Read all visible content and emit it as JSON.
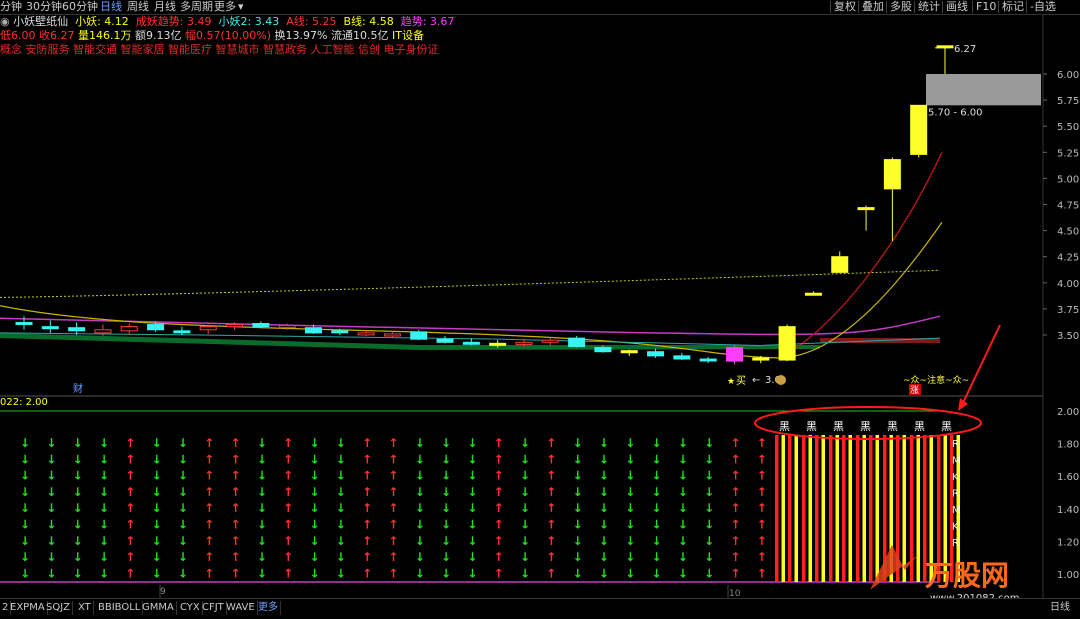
{
  "toolbar": {
    "left_items": [
      "分钟",
      "30分钟",
      "60分钟",
      "日线",
      "周线",
      "月线",
      "多周期",
      "更多"
    ],
    "active": "日线",
    "right_items": [
      "复权",
      "叠加",
      "多股",
      "统计",
      "画线",
      "F10",
      "标记",
      "-自选"
    ]
  },
  "indicator_line": {
    "name": "小妖壁纸仙",
    "items": [
      {
        "label": "小妖:",
        "value": "4.12",
        "color": "#ffff00"
      },
      {
        "label": "成妖趋势:",
        "value": "3.49",
        "color": "#ff3030"
      },
      {
        "label": "小妖2:",
        "value": "3.43",
        "color": "#3cf0f0"
      },
      {
        "label": "A线:",
        "value": "5.25",
        "color": "#ff3030"
      },
      {
        "label": "B线:",
        "value": "4.58",
        "color": "#ffff00"
      },
      {
        "label": "趋势:",
        "value": "3.67",
        "color": "#ff3cff"
      }
    ]
  },
  "quote_line": {
    "items": [
      {
        "text": "低6.00",
        "color": "#ff3030"
      },
      {
        "text": "收6.27",
        "color": "#ff3030"
      },
      {
        "text": "量146.1万",
        "color": "#ffff00"
      },
      {
        "text": "额9.13亿",
        "color": "#ddd"
      },
      {
        "text": "幅0.57(10.00%)",
        "color": "#ff3030"
      },
      {
        "text": "换13.97%",
        "color": "#ddd"
      },
      {
        "text": "流通10.5亿",
        "color": "#ddd"
      },
      {
        "text": "IT设备",
        "color": "#ffff00"
      }
    ]
  },
  "concepts": "概念 安防服务 智能交通 智能家居 智能医疗 智慧城市 智慧政务 人工智能 信创 电子身份证",
  "price_axis": [
    "6.00",
    "5.75",
    "5.50",
    "5.25",
    "5.00",
    "4.75",
    "4.50",
    "4.25",
    "4.00",
    "3.75",
    "3.50"
  ],
  "annotations": {
    "high_label": "6.27",
    "range_label": "5.70 - 6.00",
    "buy_label": "买",
    "price_mark": "3.0",
    "zhang_label": "涨",
    "wave_label": "~众~注意~众~",
    "cai_label": "财",
    "month_9": "9",
    "month_10": "10"
  },
  "lower_panel": {
    "indicator_label": "022: 2.00",
    "axis": [
      "2.00",
      "1.80",
      "1.60",
      "1.40",
      "1.20",
      "1.00"
    ],
    "top_labels": [
      "黑",
      "黑",
      "黑",
      "黑",
      "黑",
      "黑",
      "黑"
    ],
    "side_letters": [
      "R",
      "M",
      "K",
      "R",
      "M",
      "K",
      "R"
    ]
  },
  "bottom_tabs": [
    "2",
    "EXPMA",
    "SQJZ",
    "XT",
    "BBIBOLL",
    "GMMA",
    "CYX",
    "CFJT",
    "WAVE",
    "更多"
  ],
  "period_label": "日线",
  "watermark": {
    "brand": "万股网",
    "url": "www.201082.com"
  },
  "chart_data": {
    "type": "candlestick",
    "candles": [
      {
        "o": 3.62,
        "h": 3.68,
        "l": 3.55,
        "c": 3.6,
        "col": "cyan"
      },
      {
        "o": 3.58,
        "h": 3.64,
        "l": 3.52,
        "c": 3.56,
        "col": "cyan"
      },
      {
        "o": 3.57,
        "h": 3.62,
        "l": 3.5,
        "c": 3.54,
        "col": "cyan"
      },
      {
        "o": 3.52,
        "h": 3.6,
        "l": 3.49,
        "c": 3.55,
        "col": "red"
      },
      {
        "o": 3.54,
        "h": 3.61,
        "l": 3.5,
        "c": 3.58,
        "col": "red"
      },
      {
        "o": 3.6,
        "h": 3.63,
        "l": 3.53,
        "c": 3.55,
        "col": "cyan"
      },
      {
        "o": 3.54,
        "h": 3.58,
        "l": 3.5,
        "c": 3.53,
        "col": "cyan"
      },
      {
        "o": 3.55,
        "h": 3.6,
        "l": 3.51,
        "c": 3.58,
        "col": "red"
      },
      {
        "o": 3.58,
        "h": 3.62,
        "l": 3.55,
        "c": 3.6,
        "col": "red"
      },
      {
        "o": 3.61,
        "h": 3.63,
        "l": 3.57,
        "c": 3.58,
        "col": "cyan"
      },
      {
        "o": 3.58,
        "h": 3.61,
        "l": 3.55,
        "c": 3.59,
        "col": "red"
      },
      {
        "o": 3.57,
        "h": 3.6,
        "l": 3.51,
        "c": 3.52,
        "col": "cyan"
      },
      {
        "o": 3.53,
        "h": 3.56,
        "l": 3.5,
        "c": 3.54,
        "col": "cyan"
      },
      {
        "o": 3.52,
        "h": 3.55,
        "l": 3.49,
        "c": 3.51,
        "col": "red"
      },
      {
        "o": 3.51,
        "h": 3.54,
        "l": 3.48,
        "c": 3.5,
        "col": "red"
      },
      {
        "o": 3.53,
        "h": 3.55,
        "l": 3.45,
        "c": 3.46,
        "col": "cyan"
      },
      {
        "o": 3.46,
        "h": 3.49,
        "l": 3.42,
        "c": 3.43,
        "col": "cyan"
      },
      {
        "o": 3.43,
        "h": 3.47,
        "l": 3.4,
        "c": 3.42,
        "col": "cyan"
      },
      {
        "o": 3.41,
        "h": 3.45,
        "l": 3.38,
        "c": 3.42,
        "col": "yellow"
      },
      {
        "o": 3.43,
        "h": 3.46,
        "l": 3.39,
        "c": 3.41,
        "col": "red"
      },
      {
        "o": 3.44,
        "h": 3.47,
        "l": 3.4,
        "c": 3.45,
        "col": "red"
      },
      {
        "o": 3.47,
        "h": 3.49,
        "l": 3.38,
        "c": 3.39,
        "col": "cyan"
      },
      {
        "o": 3.38,
        "h": 3.4,
        "l": 3.33,
        "c": 3.34,
        "col": "cyan"
      },
      {
        "o": 3.33,
        "h": 3.36,
        "l": 3.3,
        "c": 3.35,
        "col": "yellow"
      },
      {
        "o": 3.34,
        "h": 3.37,
        "l": 3.28,
        "c": 3.3,
        "col": "cyan"
      },
      {
        "o": 3.3,
        "h": 3.33,
        "l": 3.26,
        "c": 3.27,
        "col": "cyan"
      },
      {
        "o": 3.27,
        "h": 3.29,
        "l": 3.23,
        "c": 3.26,
        "col": "cyan"
      },
      {
        "o": 3.25,
        "h": 3.4,
        "l": 3.22,
        "c": 3.38,
        "col": "magenta"
      },
      {
        "o": 3.26,
        "h": 3.3,
        "l": 3.23,
        "c": 3.28,
        "col": "yellow"
      },
      {
        "o": 3.26,
        "h": 3.6,
        "l": 3.25,
        "c": 3.58,
        "col": "yellow"
      },
      {
        "o": 3.9,
        "h": 3.92,
        "l": 3.88,
        "c": 3.9,
        "col": "yellow"
      },
      {
        "o": 4.1,
        "h": 4.3,
        "l": 4.1,
        "c": 4.25,
        "col": "yellow"
      },
      {
        "o": 4.72,
        "h": 4.74,
        "l": 4.5,
        "c": 4.72,
        "col": "yellow"
      },
      {
        "o": 4.9,
        "h": 5.2,
        "l": 4.4,
        "c": 5.18,
        "col": "yellow"
      },
      {
        "o": 5.23,
        "h": 5.7,
        "l": 5.2,
        "c": 5.7,
        "col": "yellow"
      },
      {
        "o": 6.27,
        "h": 6.27,
        "l": 6.0,
        "c": 6.27,
        "col": "yellow"
      }
    ],
    "arrows": [
      "down",
      "down",
      "down",
      "down",
      "up",
      "down",
      "down",
      "up",
      "up",
      "down",
      "up",
      "down",
      "down",
      "up",
      "up",
      "down",
      "down",
      "down",
      "up",
      "down",
      "up",
      "down",
      "down",
      "down",
      "down",
      "down",
      "down",
      "up",
      "up"
    ],
    "arrow_rows": 9,
    "bars_count": 7,
    "ma_dotted_level": 4.12,
    "bottom_line_level": 1.0
  }
}
